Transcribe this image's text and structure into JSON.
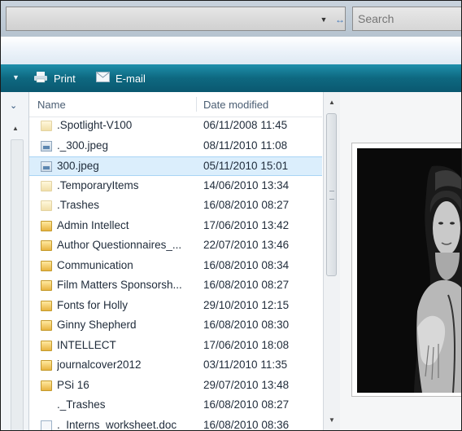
{
  "search": {
    "placeholder": "Search"
  },
  "address": {
    "refresh_glyph": "↔"
  },
  "toolbar": {
    "print_label": "Print",
    "email_label": "E-mail"
  },
  "columns": {
    "name": "Name",
    "date_modified": "Date modified"
  },
  "files": [
    {
      "name": ".Spotlight-V100",
      "date": "06/11/2008 11:45",
      "type": "folder-ghost"
    },
    {
      "name": "._300.jpeg",
      "date": "08/11/2010 11:08",
      "type": "image"
    },
    {
      "name": "300.jpeg",
      "date": "05/11/2010 15:01",
      "type": "image",
      "selected": true
    },
    {
      "name": ".TemporaryItems",
      "date": "14/06/2010 13:34",
      "type": "folder-ghost"
    },
    {
      "name": ".Trashes",
      "date": "16/08/2010 08:27",
      "type": "folder-ghost"
    },
    {
      "name": "Admin Intellect",
      "date": "17/06/2010 13:42",
      "type": "folder"
    },
    {
      "name": "Author Questionnaires_...",
      "date": "22/07/2010 13:46",
      "type": "folder"
    },
    {
      "name": "Communication",
      "date": "16/08/2010 08:34",
      "type": "folder"
    },
    {
      "name": "Film Matters Sponsorsh...",
      "date": "16/08/2010 08:27",
      "type": "folder"
    },
    {
      "name": "Fonts for Holly",
      "date": "29/10/2010 12:15",
      "type": "folder"
    },
    {
      "name": "Ginny Shepherd",
      "date": "16/08/2010 08:30",
      "type": "folder"
    },
    {
      "name": "INTELLECT",
      "date": "17/06/2010 18:08",
      "type": "folder"
    },
    {
      "name": "journalcover2012",
      "date": "03/11/2010 11:35",
      "type": "folder"
    },
    {
      "name": "PSi 16",
      "date": "29/07/2010 13:48",
      "type": "folder"
    },
    {
      "name": "._Trashes",
      "date": "16/08/2010 08:27",
      "type": "blank"
    },
    {
      "name": "._Interns_worksheet.doc",
      "date": "16/08/2010 08:36",
      "type": "doc"
    }
  ],
  "colors": {
    "toolbar": "#0e6880",
    "selection": "#dbeefc",
    "folder": "#e8b440"
  },
  "icons": {
    "print": "printer-icon",
    "email": "email-icon",
    "folder": "folder-icon",
    "image": "image-file-icon"
  }
}
